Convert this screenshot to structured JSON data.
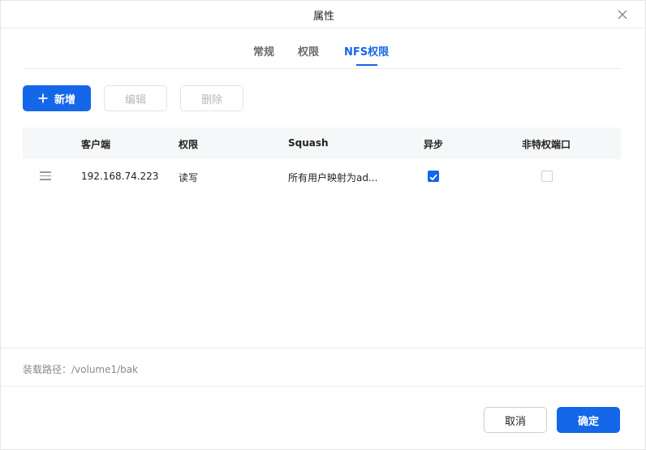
{
  "dialog": {
    "title": "属性",
    "close_icon": "close-icon"
  },
  "tabs": [
    {
      "label": "常规",
      "active": false
    },
    {
      "label": "权限",
      "active": false
    },
    {
      "label": "NFS权限",
      "active": true
    }
  ],
  "toolbar": {
    "add_label": "新增",
    "edit_label": "编辑",
    "delete_label": "删除"
  },
  "table": {
    "columns": [
      "客户端",
      "权限",
      "Squash",
      "异步",
      "非特权端口"
    ],
    "rows": [
      {
        "client": "192.168.74.223",
        "permission": "读写",
        "squash": "所有用户映射为ad...",
        "async": true,
        "non_privileged_port": false
      }
    ]
  },
  "mount_path": "装载路径：/volume1/bak",
  "footer": {
    "cancel_label": "取消",
    "ok_label": "确定"
  },
  "colors": {
    "accent": "#1467e8",
    "header_bg": "#f6f7f8"
  }
}
